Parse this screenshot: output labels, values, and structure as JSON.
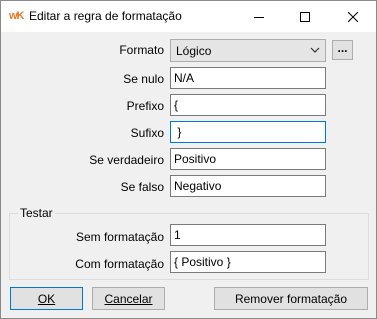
{
  "window": {
    "title": "Editar a regra de formatação",
    "app_icon": "wK"
  },
  "form": {
    "formato": {
      "label": "Formato",
      "value": "Lógico"
    },
    "se_nulo": {
      "label": "Se nulo",
      "value": "N/A"
    },
    "prefixo": {
      "label": "Prefixo",
      "value": "{"
    },
    "sufixo": {
      "label": "Sufixo",
      "value": " }"
    },
    "se_verdadeiro": {
      "label": "Se verdadeiro",
      "value": "Positivo"
    },
    "se_falso": {
      "label": "Se falso",
      "value": "Negativo"
    }
  },
  "testar": {
    "group_label": "Testar",
    "sem_formatacao": {
      "label": "Sem formatação",
      "value": "1"
    },
    "com_formatacao": {
      "label": "Com formatação",
      "value": "{ Positivo }"
    }
  },
  "buttons": {
    "ok": "OK",
    "cancelar": "Cancelar",
    "remover": "Remover formatação",
    "ellipsis": "..."
  },
  "icons": {
    "minimize": "minimize-icon",
    "maximize": "maximize-icon",
    "close": "close-icon",
    "dropdown": "chevron-down-icon"
  },
  "colors": {
    "focus_border": "#0078d7",
    "dialog_bg": "#f0f0f0"
  }
}
